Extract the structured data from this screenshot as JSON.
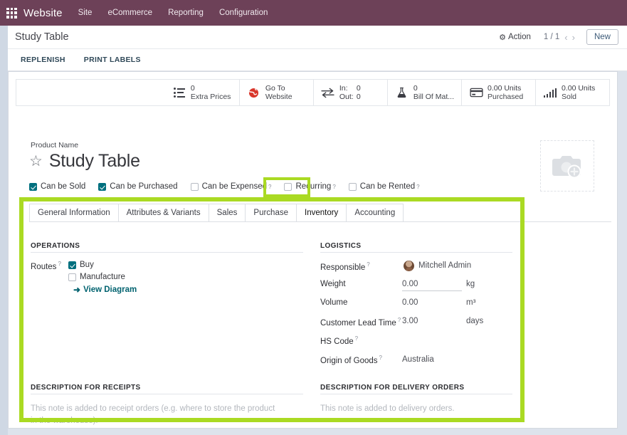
{
  "navbar": {
    "apps_icon": "apps-grid-icon",
    "brand": "Website",
    "items": [
      {
        "label": "Site"
      },
      {
        "label": "eCommerce"
      },
      {
        "label": "Reporting"
      },
      {
        "label": "Configuration"
      }
    ]
  },
  "control_panel": {
    "breadcrumb": "Study Table",
    "action_label": "Action",
    "gear_icon": "gear-icon",
    "pager": "1 / 1",
    "prev_icon": "chevron-left-icon",
    "next_icon": "chevron-right-icon",
    "new_label": "New"
  },
  "button_bar": {
    "buttons": [
      {
        "label": "REPLENISH"
      },
      {
        "label": "PRINT LABELS"
      }
    ]
  },
  "stat_buttons": [
    {
      "icon": "list-icon",
      "value": "0",
      "label": "Extra Prices"
    },
    {
      "icon": "globe-icon",
      "value": "Go To",
      "label": "Website"
    },
    {
      "icon": "exchange-icon",
      "in_label": "In:",
      "in_value": "0",
      "out_label": "Out:",
      "out_value": "0"
    },
    {
      "icon": "flask-icon",
      "value": "0",
      "label": "Bill Of Mat..."
    },
    {
      "icon": "credit-card-icon",
      "value": "0.00 Units",
      "label": "Purchased"
    },
    {
      "icon": "bar-chart-icon",
      "value": "0.00 Units",
      "label": "Sold"
    }
  ],
  "product": {
    "name_label": "Product Name",
    "favorite_icon": "star-outline-icon",
    "name": "Study Table",
    "image_placeholder_icon": "camera-add-icon"
  },
  "checkboxes": [
    {
      "label": "Can be Sold",
      "checked": true,
      "help": false
    },
    {
      "label": "Can be Purchased",
      "checked": true,
      "help": false
    },
    {
      "label": "Can be Expensed",
      "checked": false,
      "help": true
    },
    {
      "label": "Recurring",
      "checked": false,
      "help": true
    },
    {
      "label": "Can be Rented",
      "checked": false,
      "help": true
    }
  ],
  "tabs": [
    {
      "label": "General Information",
      "active": false
    },
    {
      "label": "Attributes & Variants",
      "active": false
    },
    {
      "label": "Sales",
      "active": false
    },
    {
      "label": "Purchase",
      "active": false
    },
    {
      "label": "Inventory",
      "active": true
    },
    {
      "label": "Accounting",
      "active": false
    }
  ],
  "inventory": {
    "operations": {
      "title": "OPERATIONS",
      "routes_label": "Routes",
      "routes_help": "?",
      "routes": [
        {
          "label": "Buy",
          "checked": true
        },
        {
          "label": "Manufacture",
          "checked": false
        }
      ],
      "view_diagram": "View Diagram",
      "view_diagram_icon": "arrow-right-icon"
    },
    "logistics": {
      "title": "LOGISTICS",
      "fields": [
        {
          "label": "Responsible",
          "help": true,
          "value": "Mitchell Admin",
          "unit": "",
          "avatar": true
        },
        {
          "label": "Weight",
          "help": false,
          "value": "0.00",
          "unit": "kg",
          "underline": true
        },
        {
          "label": "Volume",
          "help": false,
          "value": "0.00",
          "unit": "m³"
        },
        {
          "label": "Customer Lead Time",
          "help": true,
          "value": "3.00",
          "unit": "days"
        },
        {
          "label": "HS Code",
          "help": true,
          "value": "",
          "unit": ""
        },
        {
          "label": "Origin of Goods",
          "help": true,
          "value": "Australia",
          "unit": ""
        }
      ]
    },
    "description_receipts": {
      "title": "DESCRIPTION FOR RECEIPTS",
      "placeholder": "This note is added to receipt orders (e.g. where to store the product in the warehouse)."
    },
    "description_delivery": {
      "title": "DESCRIPTION FOR DELIVERY ORDERS",
      "placeholder": "This note is added to delivery orders."
    }
  },
  "annotations": {
    "highlight_color": "#aada23",
    "inventory_tab_box": "inventory-tab-highlight",
    "inventory_panel_box": "inventory-panel-highlight"
  },
  "colors": {
    "navbar": "#6d4158",
    "accent_teal": "#00707f",
    "link": "#00626f",
    "highlight": "#aada23"
  }
}
